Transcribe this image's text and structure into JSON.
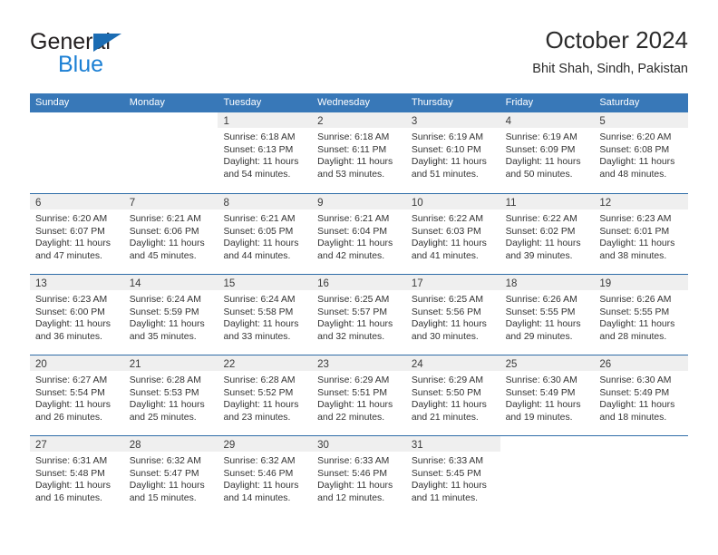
{
  "brand": {
    "name_part1": "General",
    "name_part2": "Blue",
    "triangle_color": "#1b6cb3",
    "blue_color": "#1b7fd4"
  },
  "header": {
    "title": "October 2024",
    "location": "Bhit Shah, Sindh, Pakistan"
  },
  "theme": {
    "header_blue": "#3878b8",
    "row_line_blue": "#2f6da8",
    "daybar_gray": "#efefef"
  },
  "weekday_headers": [
    "Sunday",
    "Monday",
    "Tuesday",
    "Wednesday",
    "Thursday",
    "Friday",
    "Saturday"
  ],
  "weeks": [
    [
      {
        "blank": true,
        "day": "",
        "lines": []
      },
      {
        "blank": true,
        "day": "",
        "lines": []
      },
      {
        "day": "1",
        "lines": [
          "Sunrise: 6:18 AM",
          "Sunset: 6:13 PM",
          "Daylight: 11 hours",
          "and 54 minutes."
        ]
      },
      {
        "day": "2",
        "lines": [
          "Sunrise: 6:18 AM",
          "Sunset: 6:11 PM",
          "Daylight: 11 hours",
          "and 53 minutes."
        ]
      },
      {
        "day": "3",
        "lines": [
          "Sunrise: 6:19 AM",
          "Sunset: 6:10 PM",
          "Daylight: 11 hours",
          "and 51 minutes."
        ]
      },
      {
        "day": "4",
        "lines": [
          "Sunrise: 6:19 AM",
          "Sunset: 6:09 PM",
          "Daylight: 11 hours",
          "and 50 minutes."
        ]
      },
      {
        "day": "5",
        "lines": [
          "Sunrise: 6:20 AM",
          "Sunset: 6:08 PM",
          "Daylight: 11 hours",
          "and 48 minutes."
        ]
      }
    ],
    [
      {
        "day": "6",
        "lines": [
          "Sunrise: 6:20 AM",
          "Sunset: 6:07 PM",
          "Daylight: 11 hours",
          "and 47 minutes."
        ]
      },
      {
        "day": "7",
        "lines": [
          "Sunrise: 6:21 AM",
          "Sunset: 6:06 PM",
          "Daylight: 11 hours",
          "and 45 minutes."
        ]
      },
      {
        "day": "8",
        "lines": [
          "Sunrise: 6:21 AM",
          "Sunset: 6:05 PM",
          "Daylight: 11 hours",
          "and 44 minutes."
        ]
      },
      {
        "day": "9",
        "lines": [
          "Sunrise: 6:21 AM",
          "Sunset: 6:04 PM",
          "Daylight: 11 hours",
          "and 42 minutes."
        ]
      },
      {
        "day": "10",
        "lines": [
          "Sunrise: 6:22 AM",
          "Sunset: 6:03 PM",
          "Daylight: 11 hours",
          "and 41 minutes."
        ]
      },
      {
        "day": "11",
        "lines": [
          "Sunrise: 6:22 AM",
          "Sunset: 6:02 PM",
          "Daylight: 11 hours",
          "and 39 minutes."
        ]
      },
      {
        "day": "12",
        "lines": [
          "Sunrise: 6:23 AM",
          "Sunset: 6:01 PM",
          "Daylight: 11 hours",
          "and 38 minutes."
        ]
      }
    ],
    [
      {
        "day": "13",
        "lines": [
          "Sunrise: 6:23 AM",
          "Sunset: 6:00 PM",
          "Daylight: 11 hours",
          "and 36 minutes."
        ]
      },
      {
        "day": "14",
        "lines": [
          "Sunrise: 6:24 AM",
          "Sunset: 5:59 PM",
          "Daylight: 11 hours",
          "and 35 minutes."
        ]
      },
      {
        "day": "15",
        "lines": [
          "Sunrise: 6:24 AM",
          "Sunset: 5:58 PM",
          "Daylight: 11 hours",
          "and 33 minutes."
        ]
      },
      {
        "day": "16",
        "lines": [
          "Sunrise: 6:25 AM",
          "Sunset: 5:57 PM",
          "Daylight: 11 hours",
          "and 32 minutes."
        ]
      },
      {
        "day": "17",
        "lines": [
          "Sunrise: 6:25 AM",
          "Sunset: 5:56 PM",
          "Daylight: 11 hours",
          "and 30 minutes."
        ]
      },
      {
        "day": "18",
        "lines": [
          "Sunrise: 6:26 AM",
          "Sunset: 5:55 PM",
          "Daylight: 11 hours",
          "and 29 minutes."
        ]
      },
      {
        "day": "19",
        "lines": [
          "Sunrise: 6:26 AM",
          "Sunset: 5:55 PM",
          "Daylight: 11 hours",
          "and 28 minutes."
        ]
      }
    ],
    [
      {
        "day": "20",
        "lines": [
          "Sunrise: 6:27 AM",
          "Sunset: 5:54 PM",
          "Daylight: 11 hours",
          "and 26 minutes."
        ]
      },
      {
        "day": "21",
        "lines": [
          "Sunrise: 6:28 AM",
          "Sunset: 5:53 PM",
          "Daylight: 11 hours",
          "and 25 minutes."
        ]
      },
      {
        "day": "22",
        "lines": [
          "Sunrise: 6:28 AM",
          "Sunset: 5:52 PM",
          "Daylight: 11 hours",
          "and 23 minutes."
        ]
      },
      {
        "day": "23",
        "lines": [
          "Sunrise: 6:29 AM",
          "Sunset: 5:51 PM",
          "Daylight: 11 hours",
          "and 22 minutes."
        ]
      },
      {
        "day": "24",
        "lines": [
          "Sunrise: 6:29 AM",
          "Sunset: 5:50 PM",
          "Daylight: 11 hours",
          "and 21 minutes."
        ]
      },
      {
        "day": "25",
        "lines": [
          "Sunrise: 6:30 AM",
          "Sunset: 5:49 PM",
          "Daylight: 11 hours",
          "and 19 minutes."
        ]
      },
      {
        "day": "26",
        "lines": [
          "Sunrise: 6:30 AM",
          "Sunset: 5:49 PM",
          "Daylight: 11 hours",
          "and 18 minutes."
        ]
      }
    ],
    [
      {
        "day": "27",
        "lines": [
          "Sunrise: 6:31 AM",
          "Sunset: 5:48 PM",
          "Daylight: 11 hours",
          "and 16 minutes."
        ]
      },
      {
        "day": "28",
        "lines": [
          "Sunrise: 6:32 AM",
          "Sunset: 5:47 PM",
          "Daylight: 11 hours",
          "and 15 minutes."
        ]
      },
      {
        "day": "29",
        "lines": [
          "Sunrise: 6:32 AM",
          "Sunset: 5:46 PM",
          "Daylight: 11 hours",
          "and 14 minutes."
        ]
      },
      {
        "day": "30",
        "lines": [
          "Sunrise: 6:33 AM",
          "Sunset: 5:46 PM",
          "Daylight: 11 hours",
          "and 12 minutes."
        ]
      },
      {
        "day": "31",
        "lines": [
          "Sunrise: 6:33 AM",
          "Sunset: 5:45 PM",
          "Daylight: 11 hours",
          "and 11 minutes."
        ]
      },
      {
        "blank": true,
        "day": "",
        "lines": []
      },
      {
        "blank": true,
        "day": "",
        "lines": []
      }
    ]
  ]
}
